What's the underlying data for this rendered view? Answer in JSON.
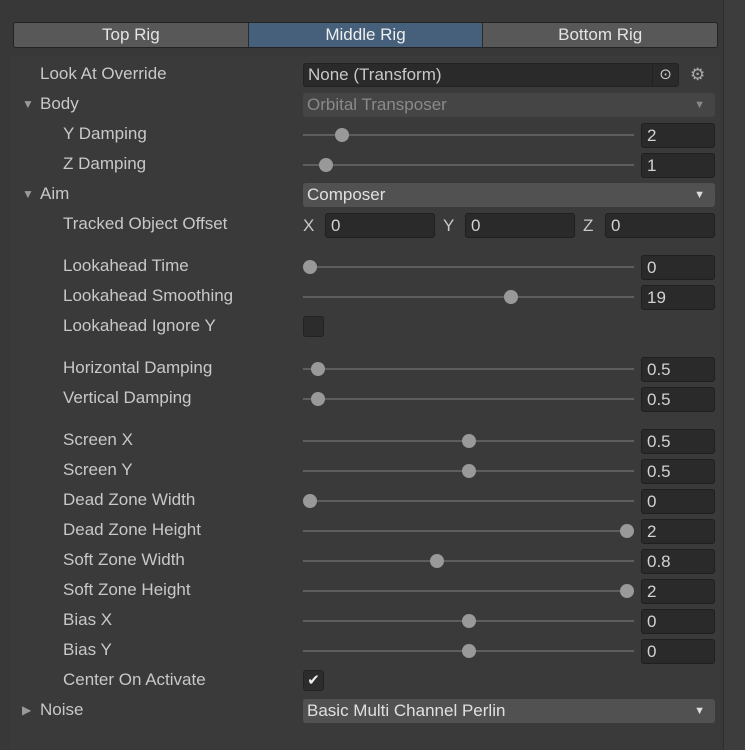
{
  "tabs": [
    {
      "label": "Top Rig",
      "active": false
    },
    {
      "label": "Middle Rig",
      "active": true
    },
    {
      "label": "Bottom Rig",
      "active": false
    }
  ],
  "rows": [
    {
      "type": "object",
      "label": "Look At Override",
      "value": "None (Transform)",
      "indent": 0
    },
    {
      "type": "dropdown",
      "label": "Body",
      "value": "Orbital Transposer",
      "indent": 0,
      "fold": "expanded",
      "disabled": true
    },
    {
      "type": "slider",
      "label": "Y Damping",
      "value": "2",
      "fraction": 0.1,
      "indent": 1
    },
    {
      "type": "slider",
      "label": "Z Damping",
      "value": "1",
      "fraction": 0.05,
      "indent": 1
    },
    {
      "type": "dropdown",
      "label": "Aim",
      "value": "Composer",
      "indent": 0,
      "fold": "expanded",
      "disabled": false
    },
    {
      "type": "vector",
      "label": "Tracked Object Offset",
      "x": "0",
      "y": "0",
      "z": "0",
      "indent": 1
    },
    {
      "type": "spacer"
    },
    {
      "type": "slider",
      "label": "Lookahead Time",
      "value": "0",
      "fraction": 0,
      "indent": 1
    },
    {
      "type": "slider",
      "label": "Lookahead Smoothing",
      "value": "19",
      "fraction": 0.633,
      "indent": 1
    },
    {
      "type": "checkbox",
      "label": "Lookahead Ignore Y",
      "checked": false,
      "indent": 1
    },
    {
      "type": "spacer"
    },
    {
      "type": "slider",
      "label": "Horizontal Damping",
      "value": "0.5",
      "fraction": 0.025,
      "indent": 1
    },
    {
      "type": "slider",
      "label": "Vertical Damping",
      "value": "0.5",
      "fraction": 0.025,
      "indent": 1
    },
    {
      "type": "spacer"
    },
    {
      "type": "slider",
      "label": "Screen X",
      "value": "0.5",
      "fraction": 0.5,
      "indent": 1
    },
    {
      "type": "slider",
      "label": "Screen Y",
      "value": "0.5",
      "fraction": 0.5,
      "indent": 1
    },
    {
      "type": "slider",
      "label": "Dead Zone Width",
      "value": "0",
      "fraction": 0,
      "indent": 1
    },
    {
      "type": "slider",
      "label": "Dead Zone Height",
      "value": "2",
      "fraction": 1,
      "indent": 1
    },
    {
      "type": "slider",
      "label": "Soft Zone Width",
      "value": "0.8",
      "fraction": 0.4,
      "indent": 1
    },
    {
      "type": "slider",
      "label": "Soft Zone Height",
      "value": "2",
      "fraction": 1,
      "indent": 1
    },
    {
      "type": "slider",
      "label": "Bias X",
      "value": "0",
      "fraction": 0.5,
      "indent": 1
    },
    {
      "type": "slider",
      "label": "Bias Y",
      "value": "0",
      "fraction": 0.5,
      "indent": 1
    },
    {
      "type": "checkbox",
      "label": "Center On Activate",
      "checked": true,
      "indent": 1
    },
    {
      "type": "dropdown",
      "label": "Noise",
      "value": "Basic Multi Channel Perlin",
      "indent": 0,
      "fold": "collapsed",
      "disabled": false
    }
  ]
}
